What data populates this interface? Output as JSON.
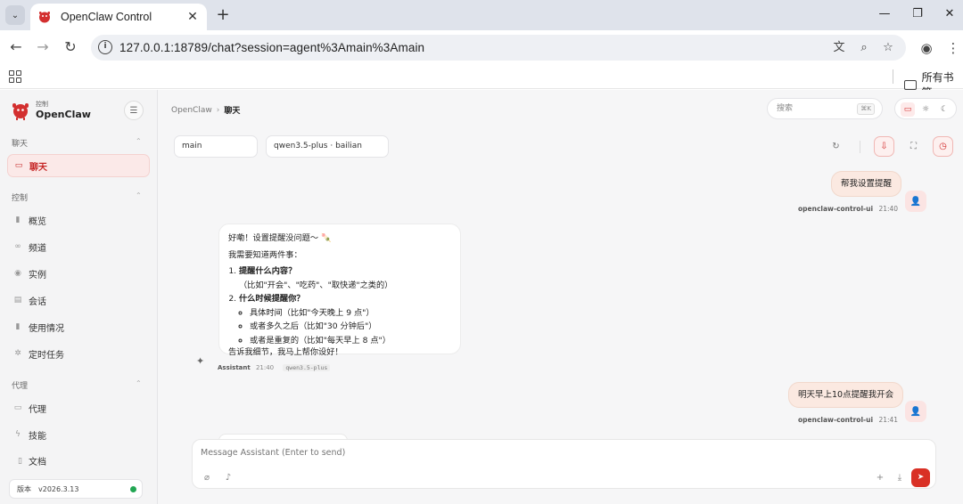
{
  "browser": {
    "tab_title": "OpenClaw Control",
    "url": "127.0.0.1:18789/chat?session=agent%3Amain%3Amain",
    "bookmarks_all": "所有书签"
  },
  "sidebar": {
    "brand_sub": "控制",
    "brand_name": "OpenClaw",
    "sections": {
      "chat": "聊天",
      "control": "控制",
      "agent": "代理"
    },
    "items": {
      "chat": "聊天",
      "overview": "概览",
      "channels": "频道",
      "instances": "实例",
      "sessions": "会话",
      "usage": "使用情况",
      "cron": "定时任务",
      "agents": "代理",
      "skills": "技能"
    },
    "docs": "文档",
    "version_label": "版本",
    "version": "v2026.3.13"
  },
  "header": {
    "breadcrumb_root": "OpenClaw",
    "breadcrumb_current": "聊天",
    "search_placeholder": "搜索",
    "search_kbd": "⌘K"
  },
  "chat_controls": {
    "session": "main",
    "model": "qwen3.5-plus · bailian"
  },
  "messages": {
    "user1": {
      "text": "帮我设置提醒",
      "sender": "openclaw-control-ui",
      "time": "21:40"
    },
    "assistant": {
      "intro": "好嘞！设置提醒没问题～ 🍡",
      "lead": "我需要知道两件事：",
      "q1_bold": "提醒什么内容？",
      "q1_rest": "（比如\"开会\"、\"吃药\"、\"取快递\"之类的）",
      "q2_bold": "什么时候提醒你？",
      "opt1": "具体时间（比如\"今天晚上 9 点\"）",
      "opt2": "或者多久之后（比如\"30 分钟后\"）",
      "opt3": "或者是重复的（比如\"每天早上 8 点\"）",
      "outro": "告诉我细节，我马上帮你设好！",
      "sender": "Assistant",
      "time": "21:40",
      "model": "qwen3.5-plus"
    },
    "user2": {
      "text": "明天早上10点提醒我开会",
      "sender": "openclaw-control-ui",
      "time": "21:41"
    }
  },
  "composer": {
    "placeholder": "Message Assistant (Enter to send)"
  },
  "colors": {
    "accent": "#d93025",
    "user_bubble": "#fbe9e1",
    "status_online": "#22a653"
  }
}
